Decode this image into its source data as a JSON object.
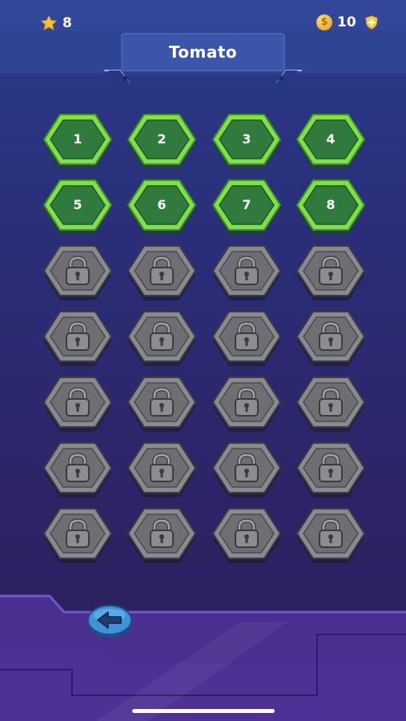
{
  "status": {
    "stars": "8",
    "coins": "10",
    "coin_symbol": "$",
    "star_icon": "star-icon",
    "coin_icon": "coin-icon",
    "add_icon": "shield-plus-icon"
  },
  "header": {
    "title": "Tomato"
  },
  "levels": {
    "unlocked": [
      "1",
      "2",
      "3",
      "4",
      "5",
      "6",
      "7",
      "8"
    ],
    "locked_count": 20,
    "columns": 4,
    "rows": 7,
    "locked_icon": "padlock-icon"
  },
  "nav": {
    "back_icon": "arrow-left-icon"
  },
  "colors": {
    "background_top": "#2b3b8a",
    "background_bottom": "#2d1f5c",
    "unlocked_fill": "#2f7a3c",
    "unlocked_rim": "#7fe04a",
    "locked_fill": "#6f6f73",
    "bottom_panel": "#4a2f8f",
    "back_button": "#3f93d6"
  }
}
